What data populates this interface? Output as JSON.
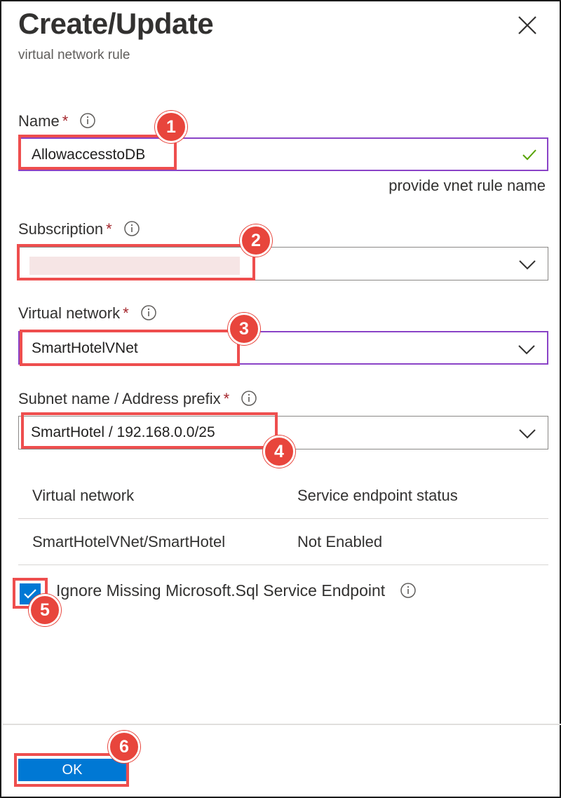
{
  "header": {
    "title": "Create/Update",
    "subtitle": "virtual network rule"
  },
  "form": {
    "name": {
      "label": "Name",
      "required_mark": "*",
      "value": "AllowaccesstoDB",
      "hint": "provide vnet rule name",
      "valid": true
    },
    "subscription": {
      "label": "Subscription",
      "required_mark": "*",
      "value": ""
    },
    "virtual_network": {
      "label": "Virtual network",
      "required_mark": "*",
      "value": "SmartHotelVNet"
    },
    "subnet": {
      "label": "Subnet name / Address prefix",
      "required_mark": "*",
      "value": "SmartHotel / 192.168.0.0/25"
    }
  },
  "table": {
    "headers": [
      "Virtual network",
      "Service endpoint status"
    ],
    "rows": [
      [
        "SmartHotelVNet/SmartHotel",
        "Not Enabled"
      ]
    ]
  },
  "ignore_missing": {
    "label": "Ignore Missing Microsoft.Sql Service Endpoint",
    "checked": true
  },
  "footer": {
    "ok_label": "OK"
  },
  "callouts": [
    "1",
    "2",
    "3",
    "4",
    "5",
    "6"
  ],
  "colors": {
    "accent": "#0078d4",
    "focus_border": "#8a43c7",
    "highlight": "#ee4e4e",
    "valid_check": "#57a300"
  },
  "icons": [
    "close-icon",
    "info-icon",
    "checkmark-icon",
    "chevron-down-icon"
  ]
}
